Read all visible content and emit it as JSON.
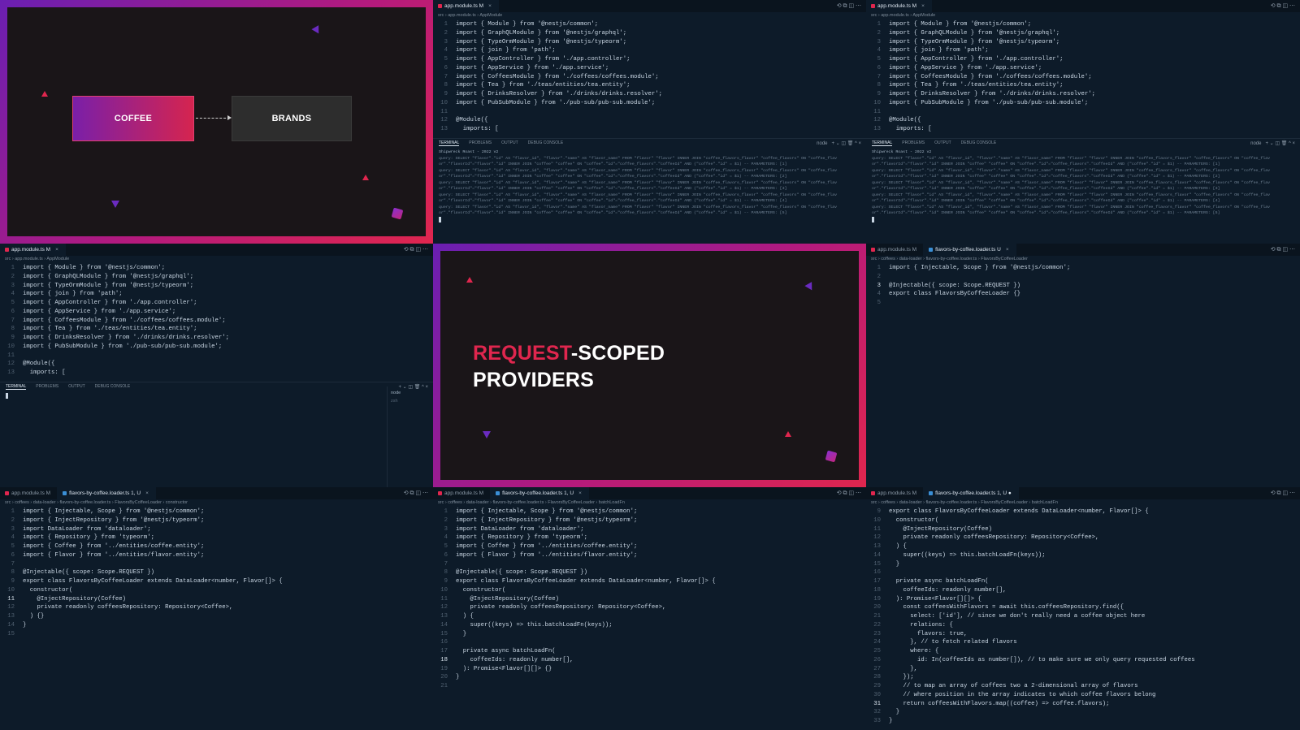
{
  "slides": {
    "diagram": {
      "box1": "COFFEE",
      "box2": "BRANDS"
    },
    "title": {
      "accent": "REQUEST",
      "rest": "-SCOPED",
      "line2": "PROVIDERS"
    }
  },
  "icons": {
    "close": "×",
    "actions": "⟲ ⧉ ◫ ⋯",
    "term_actions": "+ ⌄ ◫ 🗑 ^ ×"
  },
  "tabs": {
    "app_module": "app.module.ts M",
    "app_module_nox": "app.module.ts M",
    "flavors_loader_u": "flavors-by-coffee.loader.ts U",
    "flavors_loader_1u": "flavors-by-coffee.loader.ts 1, U",
    "flavors_loader_1u_dot": "flavors-by-coffee.loader.ts 1, U ●"
  },
  "crumbs": {
    "app_module": "src › app.module.ts › AppModule",
    "loader_class": "src › coffees › data-loader › flavors-by-coffee.loader.ts › FlavorsByCoffeeLoader",
    "loader_ctor": "src › coffees › data-loader › flavors-by-coffee.loader.ts › FlavorsByCoffeeLoader › constructor",
    "loader_batch": "src › coffees › data-loader › flavors-by-coffee.loader.ts › FlavorsByCoffeeLoader › batchLoadFn"
  },
  "terminal_tabs": {
    "terminal": "TERMINAL",
    "problems": "PROBLEMS",
    "output": "OUTPUT",
    "debug": "DEBUG CONSOLE",
    "node": "node"
  },
  "side_list": {
    "node": "node",
    "zsh": "zsh"
  },
  "terminal_log": {
    "header": "Shipwreck Roast - 2022 v2",
    "lines": [
      "query: SELECT \"flavor\".\"id\" AS \"flavor_id\", \"flavor\".\"name\" AS \"flavor_name\" FROM \"flavor\" \"flavor\" INNER JOIN \"coffee_flavors_flavor\" \"coffee_flavors\" ON \"coffee_flav",
      "or\".\"flavorId\"=\"flavor\".\"id\" INNER JOIN \"coffee\" \"coffee\" ON \"coffee\".\"id\"=\"coffee_flavors\".\"coffeeId\" AND (\"coffee\".\"id\" = $1) -- PARAMETERS: [1]",
      "query: SELECT \"flavor\".\"id\" AS \"flavor_id\", \"flavor\".\"name\" AS \"flavor_name\" FROM \"flavor\" \"flavor\" INNER JOIN \"coffee_flavors_flavor\" \"coffee_flavors\" ON \"coffee_flav",
      "or\".\"flavorId\"=\"flavor\".\"id\" INNER JOIN \"coffee\" \"coffee\" ON \"coffee\".\"id\"=\"coffee_flavors\".\"coffeeId\" AND (\"coffee\".\"id\" = $1) -- PARAMETERS: [2]",
      "query: SELECT \"flavor\".\"id\" AS \"flavor_id\", \"flavor\".\"name\" AS \"flavor_name\" FROM \"flavor\" \"flavor\" INNER JOIN \"coffee_flavors_flavor\" \"coffee_flavors\" ON \"coffee_flav",
      "or\".\"flavorId\"=\"flavor\".\"id\" INNER JOIN \"coffee\" \"coffee\" ON \"coffee\".\"id\"=\"coffee_flavors\".\"coffeeId\" AND (\"coffee\".\"id\" = $1) -- PARAMETERS: [3]",
      "query: SELECT \"flavor\".\"id\" AS \"flavor_id\", \"flavor\".\"name\" AS \"flavor_name\" FROM \"flavor\" \"flavor\" INNER JOIN \"coffee_flavors_flavor\" \"coffee_flavors\" ON \"coffee_flav",
      "or\".\"flavorId\"=\"flavor\".\"id\" INNER JOIN \"coffee\" \"coffee\" ON \"coffee\".\"id\"=\"coffee_flavors\".\"coffeeId\" AND (\"coffee\".\"id\" = $1) -- PARAMETERS: [4]",
      "query: SELECT \"flavor\".\"id\" AS \"flavor_id\", \"flavor\".\"name\" AS \"flavor_name\" FROM \"flavor\" \"flavor\" INNER JOIN \"coffee_flavors_flavor\" \"coffee_flavors\" ON \"coffee_flav",
      "or\".\"flavorId\"=\"flavor\".\"id\" INNER JOIN \"coffee\" \"coffee\" ON \"coffee\".\"id\"=\"coffee_flavors\".\"coffeeId\" AND (\"coffee\".\"id\" = $1) -- PARAMETERS: [5]"
    ]
  },
  "code": {
    "app_module": [
      {
        "n": "1",
        "t": "import { Module } from '@nestjs/common';"
      },
      {
        "n": "2",
        "t": "import { GraphQLModule } from '@nestjs/graphql';"
      },
      {
        "n": "3",
        "t": "import { TypeOrmModule } from '@nestjs/typeorm';"
      },
      {
        "n": "4",
        "t": "import { join } from 'path';"
      },
      {
        "n": "5",
        "t": "import { AppController } from './app.controller';"
      },
      {
        "n": "6",
        "t": "import { AppService } from './app.service';"
      },
      {
        "n": "7",
        "t": "import { CoffeesModule } from './coffees/coffees.module';"
      },
      {
        "n": "8",
        "t": "import { Tea } from './teas/entities/tea.entity';"
      },
      {
        "n": "9",
        "t": "import { DrinksResolver } from './drinks/drinks.resolver';"
      },
      {
        "n": "10",
        "t": "import { PubSubModule } from './pub-sub/pub-sub.module';"
      },
      {
        "n": "11",
        "t": ""
      },
      {
        "n": "12",
        "t": "@Module({"
      },
      {
        "n": "13",
        "t": "  imports: ["
      }
    ],
    "loader_min": [
      {
        "n": "1",
        "t": "import { Injectable, Scope } from '@nestjs/common';"
      },
      {
        "n": "2",
        "t": ""
      },
      {
        "n": "3",
        "t": "@Injectable({ scope: Scope.REQUEST })",
        "cur": true
      },
      {
        "n": "4",
        "t": "export class FlavorsByCoffeeLoader {}"
      },
      {
        "n": "5",
        "t": ""
      }
    ],
    "loader_ctor": [
      {
        "n": "1",
        "t": "import { Injectable, Scope } from '@nestjs/common';"
      },
      {
        "n": "2",
        "t": "import { InjectRepository } from '@nestjs/typeorm';"
      },
      {
        "n": "3",
        "t": "import DataLoader from 'dataloader';"
      },
      {
        "n": "4",
        "t": "import { Repository } from 'typeorm';"
      },
      {
        "n": "5",
        "t": "import { Coffee } from '../entities/coffee.entity';"
      },
      {
        "n": "6",
        "t": "import { Flavor } from '../entities/flavor.entity';"
      },
      {
        "n": "7",
        "t": ""
      },
      {
        "n": "8",
        "t": "@Injectable({ scope: Scope.REQUEST })"
      },
      {
        "n": "9",
        "t": "export class FlavorsByCoffeeLoader extends DataLoader<number, Flavor[]> {"
      },
      {
        "n": "10",
        "t": "  constructor("
      },
      {
        "n": "11",
        "t": "    @InjectRepository(Coffee)",
        "cur": true
      },
      {
        "n": "12",
        "t": "    private readonly coffeesRepository: Repository<Coffee>,"
      },
      {
        "n": "13",
        "t": "  ) {}"
      },
      {
        "n": "14",
        "t": "}"
      },
      {
        "n": "15",
        "t": ""
      }
    ],
    "loader_batch": [
      {
        "n": "1",
        "t": "import { Injectable, Scope } from '@nestjs/common';"
      },
      {
        "n": "2",
        "t": "import { InjectRepository } from '@nestjs/typeorm';"
      },
      {
        "n": "3",
        "t": "import DataLoader from 'dataloader';"
      },
      {
        "n": "4",
        "t": "import { Repository } from 'typeorm';"
      },
      {
        "n": "5",
        "t": "import { Coffee } from '../entities/coffee.entity';"
      },
      {
        "n": "6",
        "t": "import { Flavor } from '../entities/flavor.entity';"
      },
      {
        "n": "7",
        "t": ""
      },
      {
        "n": "8",
        "t": "@Injectable({ scope: Scope.REQUEST })"
      },
      {
        "n": "9",
        "t": "export class FlavorsByCoffeeLoader extends DataLoader<number, Flavor[]> {"
      },
      {
        "n": "10",
        "t": "  constructor("
      },
      {
        "n": "11",
        "t": "    @InjectRepository(Coffee)"
      },
      {
        "n": "12",
        "t": "    private readonly coffeesRepository: Repository<Coffee>,"
      },
      {
        "n": "13",
        "t": "  ) {"
      },
      {
        "n": "14",
        "t": "    super((keys) => this.batchLoadFn(keys));"
      },
      {
        "n": "15",
        "t": "  }"
      },
      {
        "n": "16",
        "t": ""
      },
      {
        "n": "17",
        "t": "  private async batchLoadFn("
      },
      {
        "n": "18",
        "t": "    coffeeIds: readonly number[],",
        "cur": true
      },
      {
        "n": "19",
        "t": "  ): Promise<Flavor[][]> {}"
      },
      {
        "n": "20",
        "t": "}"
      },
      {
        "n": "21",
        "t": ""
      }
    ],
    "loader_full": [
      {
        "n": "9",
        "t": "export class FlavorsByCoffeeLoader extends DataLoader<number, Flavor[]> {"
      },
      {
        "n": "10",
        "t": "  constructor("
      },
      {
        "n": "11",
        "t": "    @InjectRepository(Coffee)"
      },
      {
        "n": "12",
        "t": "    private readonly coffeesRepository: Repository<Coffee>,"
      },
      {
        "n": "13",
        "t": "  ) {"
      },
      {
        "n": "14",
        "t": "    super((keys) => this.batchLoadFn(keys));"
      },
      {
        "n": "15",
        "t": "  }"
      },
      {
        "n": "16",
        "t": ""
      },
      {
        "n": "17",
        "t": "  private async batchLoadFn("
      },
      {
        "n": "18",
        "t": "    coffeeIds: readonly number[],"
      },
      {
        "n": "19",
        "t": "  ): Promise<Flavor[][]> {"
      },
      {
        "n": "20",
        "t": "    const coffeesWithFlavors = await this.coffeesRepository.find({"
      },
      {
        "n": "21",
        "t": "      select: ['id'], // since we don't really need a coffee object here"
      },
      {
        "n": "22",
        "t": "      relations: {"
      },
      {
        "n": "23",
        "t": "        flavors: true,"
      },
      {
        "n": "24",
        "t": "      }, // to fetch related flavors"
      },
      {
        "n": "25",
        "t": "      where: {"
      },
      {
        "n": "26",
        "t": "        id: In(coffeeIds as number[]), // to make sure we only query requested coffees"
      },
      {
        "n": "27",
        "t": "      },"
      },
      {
        "n": "28",
        "t": "    });"
      },
      {
        "n": "29",
        "t": "    // to map an array of coffees two a 2-dimensional array of flavors"
      },
      {
        "n": "30",
        "t": "    // where position in the array indicates to which coffee flavors belong"
      },
      {
        "n": "31",
        "t": "    return coffeesWithFlavors.map((coffee) => coffee.flavors);",
        "cur": true
      },
      {
        "n": "32",
        "t": "  }"
      },
      {
        "n": "33",
        "t": "}"
      }
    ]
  }
}
